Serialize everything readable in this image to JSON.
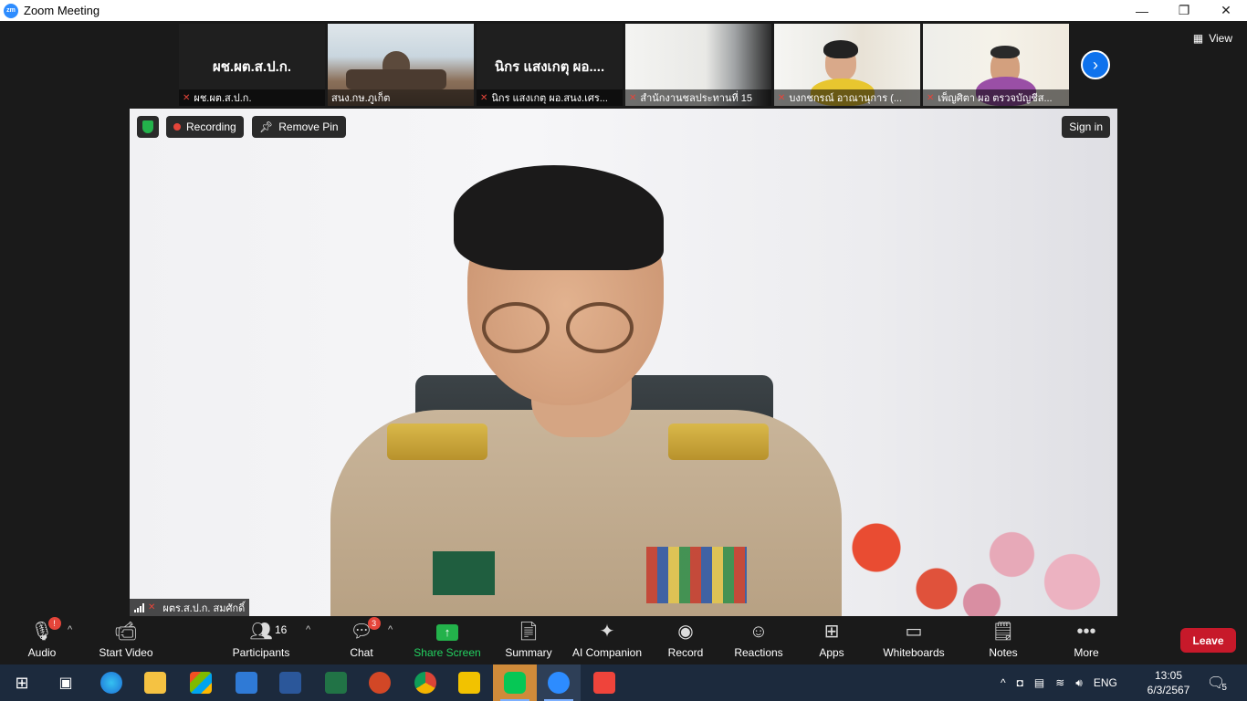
{
  "window": {
    "title": "Zoom Meeting",
    "app_icon_text": "zm",
    "minimize": "—",
    "maximize": "❐",
    "close": "✕"
  },
  "thumbnails": [
    {
      "big_name": "ผช.ผต.ส.ป.ก.",
      "caption": "ผช.ผต.ส.ป.ก."
    },
    {
      "big_name": "",
      "caption": "สนง.กษ.ภูเก็ต"
    },
    {
      "big_name": "นิกร  แสงเกตุ ผอ....",
      "caption": "นิกร  แสงเกตุ ผอ.สนง.เศร..."
    },
    {
      "big_name": "",
      "caption": "สำนักงานชลประทานที่ 15"
    },
    {
      "big_name": "",
      "caption": "บงกชกรณ์ อาณานุการ (..."
    },
    {
      "big_name": "",
      "caption": "เพ็ญศิตา ผอ ตรวจบัญชีส..."
    }
  ],
  "view_label": "View",
  "main_video": {
    "recording_label": "Recording",
    "remove_pin_label": "Remove Pin",
    "sign_in_label": "Sign in",
    "speaker_name": "ผตร.ส.ป.ก. สมศักดิ์"
  },
  "toolbar": {
    "audio": "Audio",
    "start_video": "Start Video",
    "participants": "Participants",
    "participants_count": "16",
    "chat": "Chat",
    "chat_badge": "3",
    "share_screen": "Share Screen",
    "summary": "Summary",
    "ai_companion": "AI Companion",
    "record": "Record",
    "reactions": "Reactions",
    "apps": "Apps",
    "whiteboards": "Whiteboards",
    "notes": "Notes",
    "more": "More",
    "leave": "Leave",
    "audio_badge": "!"
  },
  "taskbar": {
    "language": "ENG",
    "time": "13:05",
    "date": "6/3/2567",
    "notification_count": "5"
  },
  "colors": {
    "accent_blue": "#0e72ed",
    "share_green": "#23b24b",
    "leave_red": "#c7192a",
    "mute_red": "#e5453a",
    "taskbar_bg": "#1c2a3d"
  }
}
